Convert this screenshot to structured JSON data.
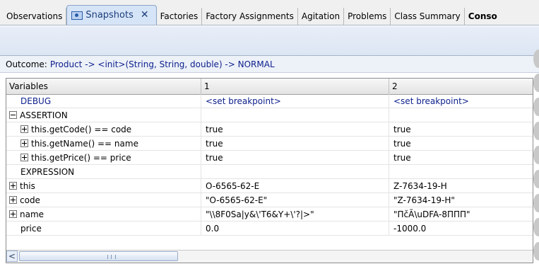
{
  "tabs": [
    {
      "label": "Observations",
      "active": false
    },
    {
      "label": "Snapshots",
      "active": true
    },
    {
      "label": "Factories",
      "active": false
    },
    {
      "label": "Factory Assignments",
      "active": false
    },
    {
      "label": "Agitation",
      "active": false
    },
    {
      "label": "Problems",
      "active": false
    },
    {
      "label": "Class Summary",
      "active": false
    },
    {
      "label": "Conso",
      "active": false
    }
  ],
  "close_glyph": "✕",
  "outcome": {
    "label": "Outcome:",
    "value": "Product -> <init>(String, String, double) -> NORMAL"
  },
  "columns": [
    "Variables",
    "1",
    "2"
  ],
  "rows": [
    {
      "name": "DEBUG",
      "indent": 1,
      "expander": "",
      "blue": true,
      "v1": "<set breakpoint>",
      "v2": "<set breakpoint>"
    },
    {
      "name": "ASSERTION",
      "indent": 0,
      "expander": "minus",
      "blue": false,
      "v1": "",
      "v2": ""
    },
    {
      "name": "this.getCode() == code",
      "indent": 1,
      "expander": "plus",
      "blue": false,
      "v1": "true",
      "v2": "true"
    },
    {
      "name": "this.getName() == name",
      "indent": 1,
      "expander": "plus",
      "blue": false,
      "v1": "true",
      "v2": "true"
    },
    {
      "name": "this.getPrice() == price",
      "indent": 1,
      "expander": "plus",
      "blue": false,
      "v1": "true",
      "v2": "true"
    },
    {
      "name": "EXPRESSION",
      "indent": 1,
      "expander": "",
      "blue": false,
      "v1": "",
      "v2": ""
    },
    {
      "name": "this",
      "indent": 0,
      "expander": "plus",
      "blue": false,
      "v1": "O-6565-62-E",
      "v2": "Z-7634-19-H"
    },
    {
      "name": "code",
      "indent": 0,
      "expander": "plus",
      "blue": false,
      "v1": "\"O-6565-62-E\"",
      "v2": "\"Z-7634-19-H\""
    },
    {
      "name": "name",
      "indent": 0,
      "expander": "plus",
      "blue": false,
      "v1": "\"\\\\8F0Sa|y&\\'T6&Y+\\'?|>\"",
      "v2": "\"ΠčÃ\\uDFA-8ΠΠΠ\""
    },
    {
      "name": "price",
      "indent": 1,
      "expander": "",
      "blue": false,
      "v1": "0.0",
      "v2": "-1000.0"
    }
  ],
  "hscroll": {
    "left_arrow": "<",
    "thumb_fraction": 0.31
  }
}
